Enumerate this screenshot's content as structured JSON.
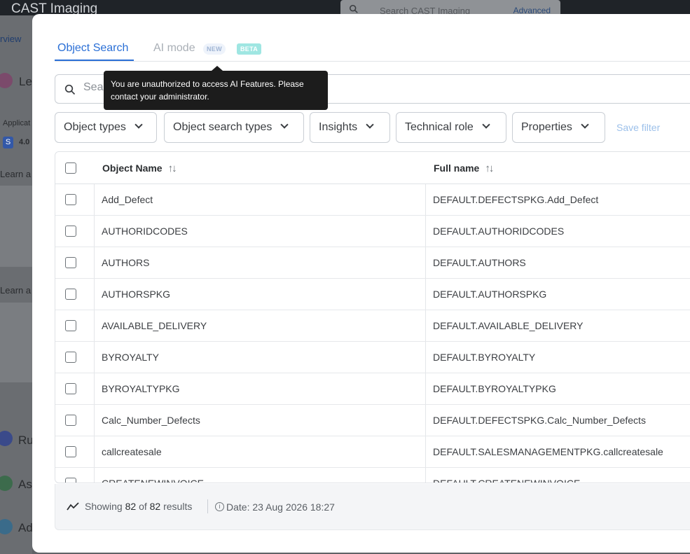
{
  "background": {
    "app_title": "CAST Imaging",
    "search_placeholder": "Search CAST Imaging",
    "advanced_label": "Advanced",
    "left_fragments": [
      "rview",
      "Le",
      "Applicat",
      "4.0",
      "Learn a",
      "Learn a",
      "Ru",
      "As",
      "Ad"
    ]
  },
  "tabs": {
    "object_search": "Object Search",
    "ai_mode": "AI mode",
    "new_badge": "NEW",
    "beta_badge": "BETA"
  },
  "tooltip": {
    "text": "You are unauthorized to access AI Features. Please contact your administrator."
  },
  "search": {
    "placeholder": "Search",
    "value": ""
  },
  "filters": {
    "object_types": "Object types",
    "object_search_types": "Object search types",
    "insights": "Insights",
    "technical_role": "Technical role",
    "properties": "Properties",
    "save_filter": "Save filter"
  },
  "table": {
    "columns": [
      "Object Name",
      "Full name"
    ],
    "rows": [
      [
        "Add_Defect",
        "DEFAULT.DEFECTSPKG.Add_Defect"
      ],
      [
        "AUTHORIDCODES",
        "DEFAULT.AUTHORIDCODES"
      ],
      [
        "AUTHORS",
        "DEFAULT.AUTHORS"
      ],
      [
        "AUTHORSPKG",
        "DEFAULT.AUTHORSPKG"
      ],
      [
        "AVAILABLE_DELIVERY",
        "DEFAULT.AVAILABLE_DELIVERY"
      ],
      [
        "BYROYALTY",
        "DEFAULT.BYROYALTY"
      ],
      [
        "BYROYALTYPKG",
        "DEFAULT.BYROYALTYPKG"
      ],
      [
        "Calc_Number_Defects",
        "DEFAULT.DEFECTSPKG.Calc_Number_Defects"
      ],
      [
        "callcreatesale",
        "DEFAULT.SALESMANAGEMENTPKG.callcreatesale"
      ],
      [
        "CREATENEWINVOICE",
        "DEFAULT.CREATENEWINVOICE"
      ]
    ]
  },
  "footer": {
    "showing_label": "Showing",
    "shown_count": "82",
    "of_label": "of",
    "total_count": "82",
    "results_label": "results",
    "date_text": "Date: 23 Aug 2026 18:27"
  },
  "colors": {
    "accent": "#2a6fd6",
    "overlay": "#5f6266",
    "tooltip_bg": "#1c1c1c"
  },
  "icons": {
    "search": "search-icon",
    "trend": "trend-line-icon",
    "info": "info-icon",
    "sort": "sort-arrows-icon",
    "chevron": "chevron-down-icon"
  }
}
